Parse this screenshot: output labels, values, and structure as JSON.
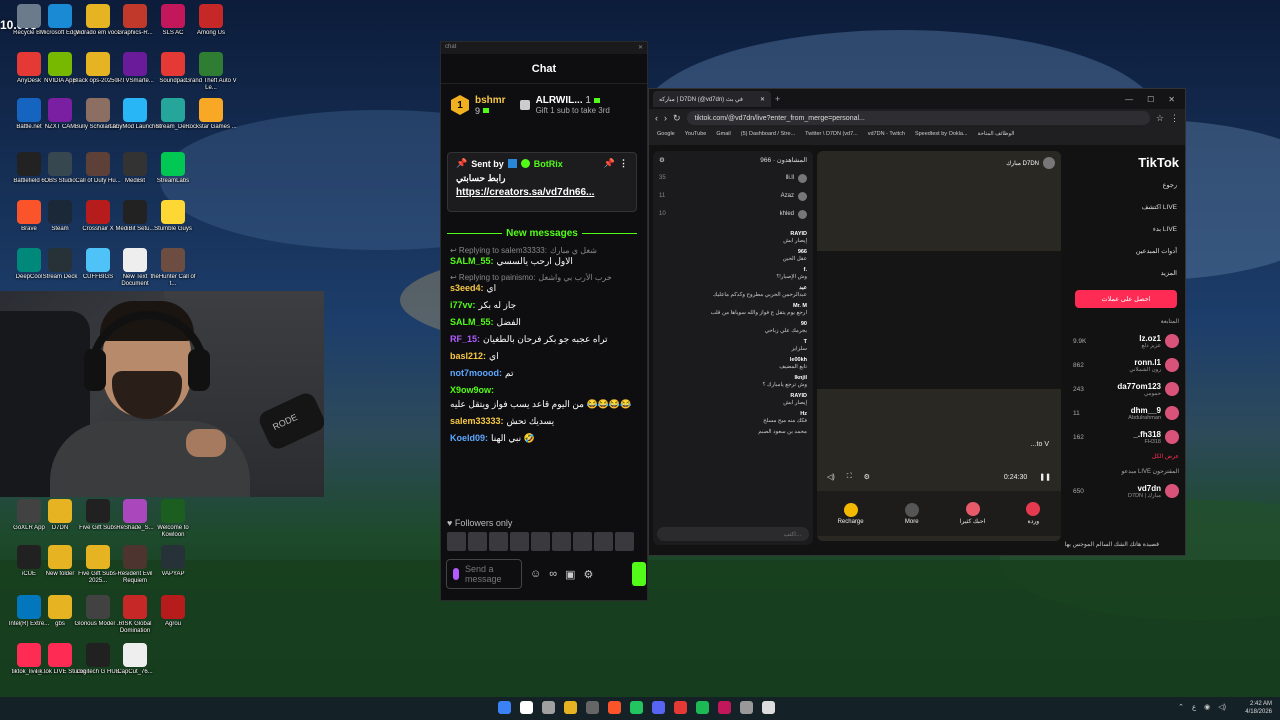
{
  "overlay": {
    "price_text": "10.00$"
  },
  "desktop_icons": [
    {
      "label": "Recycle Bin",
      "color": "#6b7b8c"
    },
    {
      "label": "Microsoft Edge",
      "color": "#1a8ad4"
    },
    {
      "label": "Vidrado em voce",
      "color": "#e6b422"
    },
    {
      "label": "Graphics-R...",
      "color": "#c0392b"
    },
    {
      "label": "SLS AC",
      "color": "#c2185b"
    },
    {
      "label": "Among Us",
      "color": "#c62828"
    },
    {
      "label": "AnyDesk",
      "color": "#e53935"
    },
    {
      "label": "NVIDIA App",
      "color": "#76b900"
    },
    {
      "label": "Black ops-20250...",
      "color": "#e6b422"
    },
    {
      "label": "IPTVSmarte...",
      "color": "#6a1b9a"
    },
    {
      "label": "Soundpad",
      "color": "#e53935"
    },
    {
      "label": "Grand Theft Auto V Le...",
      "color": "#2e7d32"
    },
    {
      "label": "Battle.net",
      "color": "#1565c0"
    },
    {
      "label": "NZXT CAM",
      "color": "#7b1fa2"
    },
    {
      "label": "Bully Scholarsh...",
      "color": "#8d6e63"
    },
    {
      "label": "LabyMod Launcher",
      "color": "#29b6f6"
    },
    {
      "label": "Stream_De...",
      "color": "#26a69a"
    },
    {
      "label": "Rockstar Games ...",
      "color": "#f9a825"
    },
    {
      "label": "Battlefield 6",
      "color": "#222222"
    },
    {
      "label": "OBS Studio",
      "color": "#37474f"
    },
    {
      "label": "Call of Duty Hu...",
      "color": "#5d4037"
    },
    {
      "label": "MediBit",
      "color": "#333333"
    },
    {
      "label": "StreamLabs",
      "color": "#00c853"
    },
    {
      "label": "Brave",
      "color": "#fb542b"
    },
    {
      "label": "Steam",
      "color": "#1b2838"
    },
    {
      "label": "Crosshair X",
      "color": "#b71c1c"
    },
    {
      "label": "MediBit Setu...",
      "color": "#222222"
    },
    {
      "label": "Stumble Guys",
      "color": "#fdd835"
    },
    {
      "label": "DeepCool",
      "color": "#00897b"
    },
    {
      "label": "Stream Deck",
      "color": "#263238"
    },
    {
      "label": "CUFFBIGS",
      "color": "#4fc3f7"
    },
    {
      "label": "New Text Document",
      "color": "#eeeeee"
    },
    {
      "label": "theHunter Call of t...",
      "color": "#6d4c41"
    },
    {
      "label": "GoXLR App",
      "color": "#424242"
    },
    {
      "label": "D7DN",
      "color": "#e6b422"
    },
    {
      "label": "Five Gift Subs",
      "color": "#212121"
    },
    {
      "label": "ReShade_S...",
      "color": "#ab47bc"
    },
    {
      "label": "Welcome to Kowloon",
      "color": "#1b5e20"
    },
    {
      "label": "iCUE",
      "color": "#212121"
    },
    {
      "label": "New folder",
      "color": "#e6b422"
    },
    {
      "label": "Five Gift Subs-2025...",
      "color": "#e6b422"
    },
    {
      "label": "Resident Evil Requiem",
      "color": "#4e342e"
    },
    {
      "label": "VAPYAP",
      "color": "#263238"
    },
    {
      "label": "Intel(R) Extre...",
      "color": "#0277bd"
    },
    {
      "label": "gbs",
      "color": "#e6b422"
    },
    {
      "label": "Glorious Model ...",
      "color": "#424242"
    },
    {
      "label": "RISK Global Domination",
      "color": "#c62828"
    },
    {
      "label": "Agrou",
      "color": "#b71c1c"
    },
    {
      "label": "tiktok_live_...",
      "color": "#fe2c55"
    },
    {
      "label": "TikTok LIVE Studio",
      "color": "#fe2c55"
    },
    {
      "label": "Logitech G HUB",
      "color": "#212121"
    },
    {
      "label": "CapCut_76...",
      "color": "#eeeeee"
    }
  ],
  "webcam": {
    "mic_brand": "RODE"
  },
  "chat": {
    "window_title": "chat",
    "header_title": "Chat",
    "leaderboard": {
      "rank": "1",
      "user": "bshmr",
      "count": "9",
      "gift_user": "ALRWIL...",
      "gift_count": "1",
      "gift_desc": "Gift 1 sub to take 3rd"
    },
    "pinned": {
      "sent_by_label": "Sent by",
      "bot_name": "BotRix",
      "line1": "رابط حسابتي",
      "link": "https://creators.sa/vd7dn66..."
    },
    "new_messages_label": "New messages",
    "messages": [
      {
        "reply_prefix": "Replying to salem33333:",
        "reply_text": "شغل ي مبارك",
        "user": "SALM_55",
        "color": "#53fc18",
        "text": "الاول ارحب يالسسي"
      },
      {
        "reply_prefix": "Replying to painismo:",
        "reply_text": "خرب الأرب بي واشغل",
        "user": "s3eed4",
        "color": "#f7c948",
        "text": "اي"
      },
      {
        "user": "i77vv",
        "color": "#53fc18",
        "text": "جاز له بكر"
      },
      {
        "user": "SALM_55",
        "color": "#53fc18",
        "text": "الفضل"
      },
      {
        "user": "RF_15",
        "color": "#b25cff",
        "text": "تراه عجبه جو بكر فرحان بالطغيان"
      },
      {
        "user": "basl212",
        "color": "#f7c948",
        "text": "اي"
      },
      {
        "user": "not7moood",
        "color": "#5ca8ff",
        "text": "تم"
      },
      {
        "user": "X9ow9ow",
        "color": "#53fc18",
        "text": "من اليوم قاعد يسب فواز ويتقل عليه 😂😂😂😂"
      },
      {
        "user": "salem33333",
        "color": "#f7c948",
        "text": "يسديك تحش"
      },
      {
        "user": "Koeld09",
        "color": "#5ca8ff",
        "text": "نبي الهنا 🤣"
      }
    ],
    "followers_only_label": "Followers only",
    "send_placeholder": "Send a message"
  },
  "browser": {
    "tab_title": "مباركه | D7DN (@vd7dn) في بث",
    "url": "tiktok.com/@vd7dn/live?enter_from_merge=personal...",
    "bookmarks": [
      "Google",
      "YouTube",
      "Gmail",
      "(5) Dashboard / Stre...",
      "Twitter \\ D7DN (vd7...",
      "vd7DN - Twitch",
      "Speedtest by Ookla...",
      "الوظائف المتاحة"
    ],
    "tiktok": {
      "viewers_label": "المشاهدون",
      "viewer_count": "966",
      "top_viewers": [
        {
          "name": "lli.ll",
          "num": "35"
        },
        {
          "name": "Azaz",
          "num": "11"
        },
        {
          "name": "khled",
          "num": "10"
        }
      ],
      "chat_msgs": [
        {
          "user": "RAYID",
          "text": "إيصار ابش"
        },
        {
          "user": "966",
          "text": "عقل الحين"
        },
        {
          "user": "f.",
          "text": "وش الإصبار!؟"
        },
        {
          "user": "عبد",
          "text": "عبدالرحمن الحربي مطروح وكذكم ماعليك"
        },
        {
          "user": "Mr. M",
          "text": "ارجع يوم يتقل ع فواز والله سوياها من قلب"
        },
        {
          "user": "90",
          "text": "يجرمك علي زباحي"
        },
        {
          "user": "T",
          "text": "سلزايز"
        },
        {
          "user": "le00kh",
          "text": "تابع المضيف"
        },
        {
          "user": "Iknjil",
          "text": "وش ترجع يامبارك ؟"
        },
        {
          "user": "RAYID",
          "text": "إيصار ابش"
        },
        {
          "user": "Hz",
          "text": "فكك منه ميح مسلح"
        },
        {
          "user": "",
          "text": "محمد بن سعود الصبم"
        }
      ],
      "chat_input_placeholder": "اكتب...",
      "streamer_name": "مبارك D7DN",
      "stream_time": "0:24:30",
      "caption": "...to V",
      "gifts": [
        {
          "label": "Recharge",
          "color": "#f5b800"
        },
        {
          "label": "More",
          "color": "#555555"
        },
        {
          "label": "احبك كثيرا",
          "color": "#e85a6a"
        },
        {
          "label": "وردة",
          "color": "#e53950"
        }
      ],
      "logo": "TikTok",
      "nav": [
        "رجوع",
        "اكتشف LIVE",
        "بدء LIVE",
        "أدوات المبدعين",
        "المزيد"
      ],
      "get_coins": "احصل على عملات",
      "following_label": "المتابعة",
      "following": [
        {
          "name": "lz.oz1",
          "sub": "عزيز دلع",
          "count": "9.9K"
        },
        {
          "name": "ronn.l1",
          "sub": "رون الشملاني",
          "count": "862"
        },
        {
          "name": "da77om123",
          "sub": "حمومي",
          "count": "243"
        },
        {
          "name": "dhm__9",
          "sub": "Abdulrahman",
          "count": "11"
        },
        {
          "name": "_.fh318",
          "sub": "FH318",
          "count": "162"
        }
      ],
      "show_all": "عرض الكل",
      "suggested_label": "مبدعو LIVE المقترحون",
      "suggested": [
        {
          "name": "vd7dn",
          "sub": "D7DN | مبارك",
          "count": "650"
        }
      ],
      "footer_caption": "قصيدة هاتك الشك السالم الموجس بها"
    }
  },
  "taskbar": {
    "time": "2:42 AM",
    "date": "4/18/2026",
    "lang": "ع"
  }
}
